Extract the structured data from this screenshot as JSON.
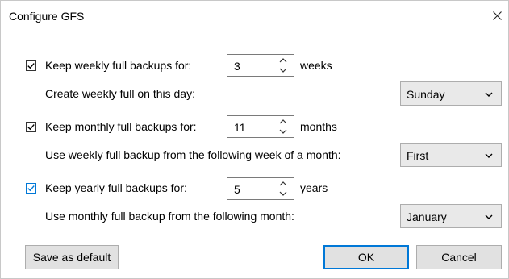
{
  "dialog": {
    "title": "Configure GFS"
  },
  "weekly": {
    "checked": true,
    "keep_label": "Keep weekly full backups for:",
    "keep_value": "3",
    "unit": "weeks",
    "day_label": "Create weekly full on this day:",
    "day_value": "Sunday"
  },
  "monthly": {
    "checked": true,
    "keep_label": "Keep monthly full backups for:",
    "keep_value": "11",
    "unit": "months",
    "week_label": "Use weekly full backup from the following week of a month:",
    "week_value": "First"
  },
  "yearly": {
    "checked": true,
    "keep_label": "Keep yearly full backups for:",
    "keep_value": "5",
    "unit": "years",
    "month_label": "Use monthly full backup from the following month:",
    "month_value": "January"
  },
  "buttons": {
    "save_default": "Save as default",
    "ok": "OK",
    "cancel": "Cancel"
  },
  "colors": {
    "accent": "#0078d7",
    "button_bg": "#e1e1e1",
    "select_bg": "#e9e9e9"
  }
}
